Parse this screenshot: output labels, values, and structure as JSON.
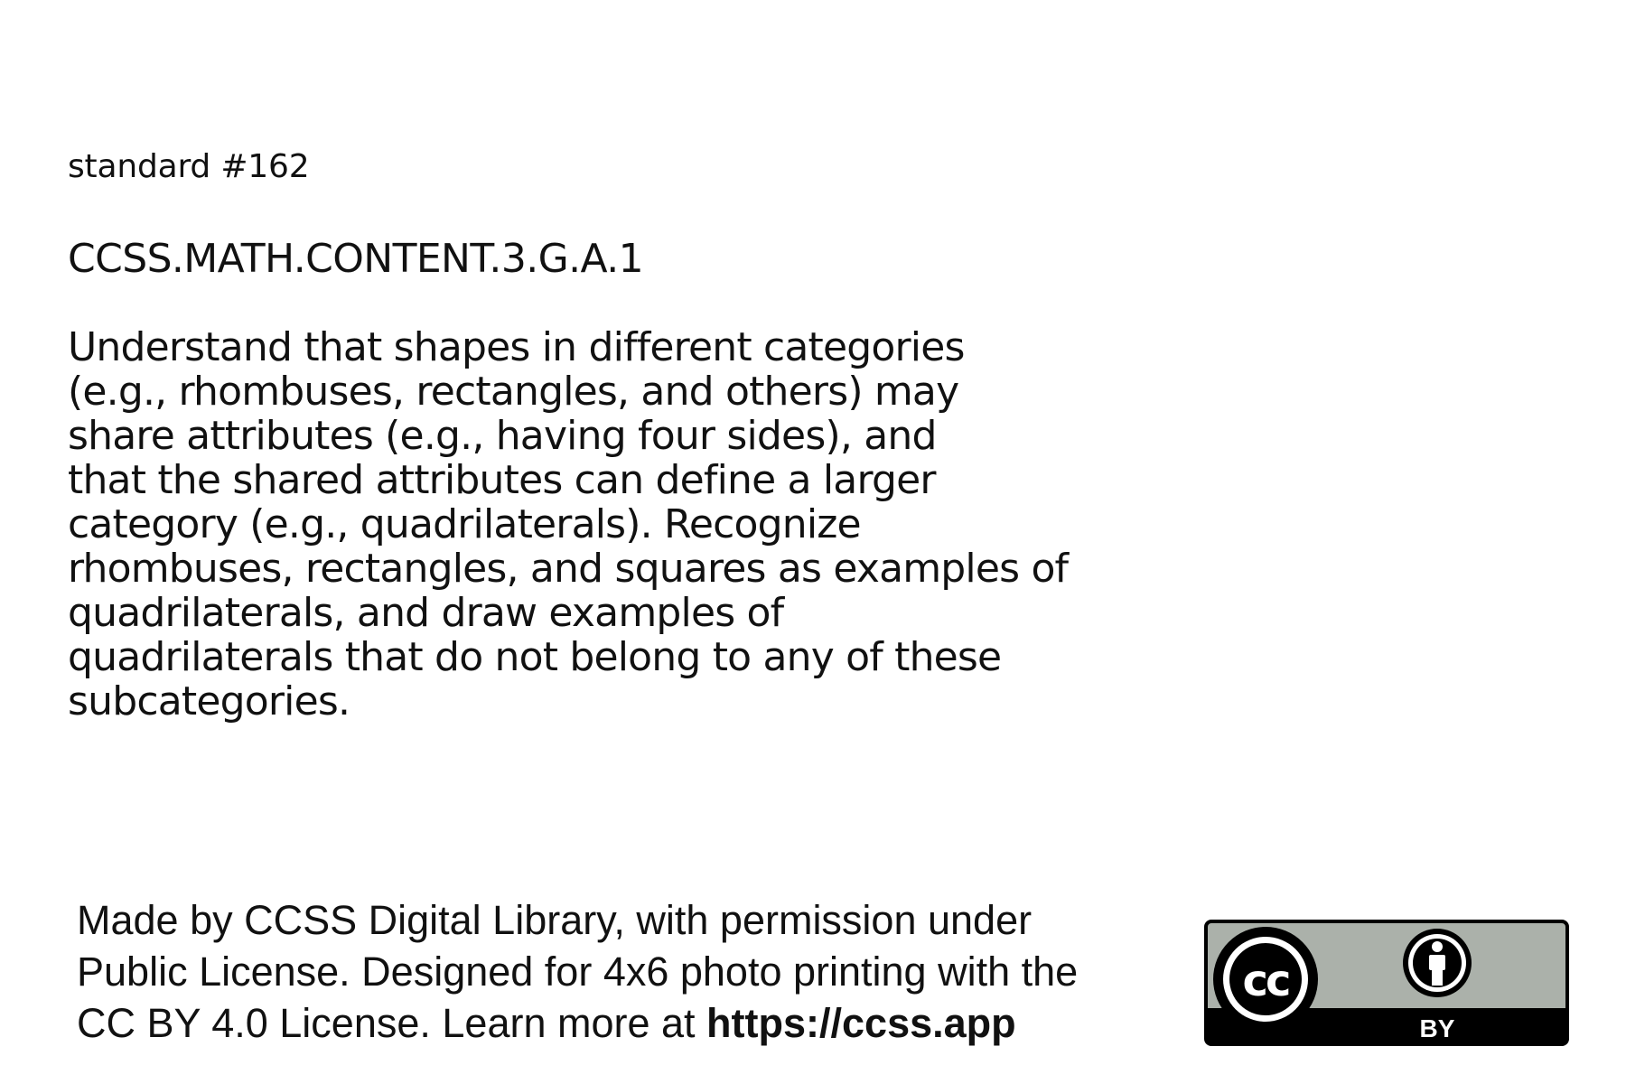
{
  "card": {
    "standard_number": "standard #162",
    "standard_code": "CCSS.MATH.CONTENT.3.G.A.1",
    "description_lines": [
      "Understand that shapes in different categories",
      "(e.g., rhombuses, rectangles, and others) may",
      "share attributes (e.g., having four sides), and",
      "that the shared attributes can define a larger",
      "category (e.g., quadrilaterals). Recognize",
      "rhombuses, rectangles, and squares as examples of",
      "quadrilaterals, and draw examples of",
      "quadrilaterals that do not belong to any of these",
      "subcategories."
    ]
  },
  "footer": {
    "line1": "Made by CCSS Digital Library, with permission under",
    "line2": "Public License. Designed for 4x6 photo printing with the",
    "line3_prefix": "CC BY 4.0 License. Learn more at ",
    "link": "https://ccss.app"
  },
  "badge": {
    "cc_text": "cc",
    "by_text": "BY",
    "icons": [
      "creative-commons-icon",
      "attribution-person-icon"
    ],
    "colors": {
      "panel": "#abb1aa",
      "band": "#000000",
      "border": "#000000",
      "icon_fill": "#ffffff"
    }
  }
}
